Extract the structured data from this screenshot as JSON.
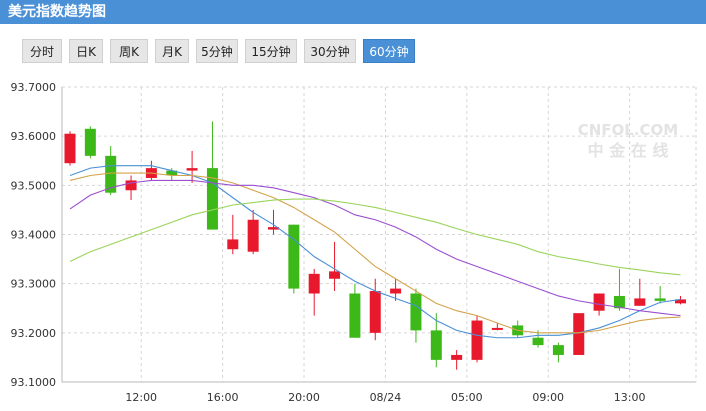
{
  "header": {
    "title": "美元指数趋势图"
  },
  "tabs": [
    {
      "label": "分时"
    },
    {
      "label": "日K"
    },
    {
      "label": "周K"
    },
    {
      "label": "月K"
    },
    {
      "label": "5分钟"
    },
    {
      "label": "15分钟"
    },
    {
      "label": "30分钟"
    },
    {
      "label": "60分钟",
      "active": true
    }
  ],
  "watermark": {
    "top": "CNFOL.COM",
    "bottom": "中 金 在 线"
  },
  "colors": {
    "up": "#e8192c",
    "down": "#3cb818",
    "grid": "#d6d6d6",
    "ma1": "#4a90d6",
    "ma2": "#d4a24a",
    "ma3": "#9b4fd0",
    "ma4": "#9ad45a"
  },
  "chart_data": {
    "type": "candlestick",
    "ylim": [
      93.1,
      93.7
    ],
    "yticks": [
      "93.7000",
      "93.6000",
      "93.5000",
      "93.4000",
      "93.3000",
      "93.2000",
      "93.1000"
    ],
    "xticks": [
      {
        "label": "12:00",
        "index": 4
      },
      {
        "label": "16:00",
        "index": 8
      },
      {
        "label": "20:00",
        "index": 12
      },
      {
        "label": "08/24",
        "index": 16
      },
      {
        "label": "05:00",
        "index": 20
      },
      {
        "label": "09:00",
        "index": 24
      },
      {
        "label": "13:00",
        "index": 28
      }
    ],
    "candles": [
      {
        "open": 93.545,
        "close": 93.605,
        "high": 93.61,
        "low": 93.54
      },
      {
        "open": 93.615,
        "close": 93.56,
        "high": 93.62,
        "low": 93.555
      },
      {
        "open": 93.56,
        "close": 93.485,
        "high": 93.58,
        "low": 93.48
      },
      {
        "open": 93.49,
        "close": 93.51,
        "high": 93.52,
        "low": 93.47
      },
      {
        "open": 93.515,
        "close": 93.535,
        "high": 93.55,
        "low": 93.51
      },
      {
        "open": 93.53,
        "close": 93.52,
        "high": 93.535,
        "low": 93.51
      },
      {
        "open": 93.53,
        "close": 93.535,
        "high": 93.57,
        "low": 93.505
      },
      {
        "open": 93.535,
        "close": 93.41,
        "high": 93.63,
        "low": 93.41
      },
      {
        "open": 93.37,
        "close": 93.39,
        "high": 93.44,
        "low": 93.36
      },
      {
        "open": 93.365,
        "close": 93.43,
        "high": 93.45,
        "low": 93.36
      },
      {
        "open": 93.41,
        "close": 93.415,
        "high": 93.45,
        "low": 93.4
      },
      {
        "open": 93.42,
        "close": 93.29,
        "high": 93.42,
        "low": 93.28
      },
      {
        "open": 93.28,
        "close": 93.32,
        "high": 93.33,
        "low": 93.235
      },
      {
        "open": 93.31,
        "close": 93.325,
        "high": 93.385,
        "low": 93.285
      },
      {
        "open": 93.28,
        "close": 93.19,
        "high": 93.3,
        "low": 93.19
      },
      {
        "open": 93.2,
        "close": 93.285,
        "high": 93.31,
        "low": 93.185
      },
      {
        "open": 93.28,
        "close": 93.29,
        "high": 93.31,
        "low": 93.265
      },
      {
        "open": 93.28,
        "close": 93.205,
        "high": 93.29,
        "low": 93.18
      },
      {
        "open": 93.205,
        "close": 93.145,
        "high": 93.24,
        "low": 93.13
      },
      {
        "open": 93.145,
        "close": 93.155,
        "high": 93.165,
        "low": 93.125
      },
      {
        "open": 93.145,
        "close": 93.225,
        "high": 93.235,
        "low": 93.14
      },
      {
        "open": 93.21,
        "close": 93.21,
        "high": 93.22,
        "low": 93.205
      },
      {
        "open": 93.215,
        "close": 93.195,
        "high": 93.225,
        "low": 93.19
      },
      {
        "open": 93.19,
        "close": 93.175,
        "high": 93.205,
        "low": 93.17
      },
      {
        "open": 93.175,
        "close": 93.155,
        "high": 93.18,
        "low": 93.14
      },
      {
        "open": 93.155,
        "close": 93.24,
        "high": 93.24,
        "low": 93.155
      },
      {
        "open": 93.245,
        "close": 93.28,
        "high": 93.28,
        "low": 93.235
      },
      {
        "open": 93.275,
        "close": 93.25,
        "high": 93.33,
        "low": 93.245
      },
      {
        "open": 93.255,
        "close": 93.27,
        "high": 93.31,
        "low": 93.255
      },
      {
        "open": 93.27,
        "close": 93.265,
        "high": 93.295,
        "low": 93.26
      },
      {
        "open": 93.26,
        "close": 93.268,
        "high": 93.275,
        "low": 93.258
      }
    ],
    "ma_lines": [
      {
        "values": [
          93.52,
          93.535,
          93.54,
          93.54,
          93.54,
          93.53,
          93.52,
          93.505,
          93.475,
          93.445,
          93.42,
          93.39,
          93.355,
          93.33,
          93.305,
          93.285,
          93.27,
          93.255,
          93.225,
          93.205,
          93.195,
          93.19,
          93.19,
          93.195,
          93.195,
          93.2,
          93.21,
          93.225,
          93.245,
          93.262,
          93.268
        ]
      },
      {
        "values": [
          93.51,
          93.52,
          93.525,
          93.525,
          93.525,
          93.52,
          93.52,
          93.515,
          93.505,
          93.49,
          93.475,
          93.455,
          93.43,
          93.405,
          93.37,
          93.335,
          93.31,
          93.285,
          93.26,
          93.245,
          93.235,
          93.22,
          93.205,
          93.2,
          93.2,
          93.2,
          93.205,
          93.215,
          93.225,
          93.23,
          93.232
        ]
      },
      {
        "values": [
          93.452,
          93.48,
          93.495,
          93.505,
          93.51,
          93.51,
          93.51,
          93.505,
          93.5,
          93.5,
          93.495,
          93.485,
          93.475,
          93.46,
          93.44,
          93.43,
          93.415,
          93.395,
          93.37,
          93.35,
          93.335,
          93.32,
          93.305,
          93.29,
          93.275,
          93.265,
          93.258,
          93.252,
          93.245,
          93.24,
          93.235
        ]
      },
      {
        "values": [
          93.345,
          93.365,
          93.38,
          93.395,
          93.41,
          93.425,
          93.44,
          93.45,
          93.46,
          93.465,
          93.47,
          93.472,
          93.472,
          93.468,
          93.462,
          93.455,
          93.445,
          93.435,
          93.425,
          93.412,
          93.4,
          93.39,
          93.38,
          93.365,
          93.355,
          93.348,
          93.34,
          93.333,
          93.328,
          93.322,
          93.318
        ]
      }
    ]
  }
}
